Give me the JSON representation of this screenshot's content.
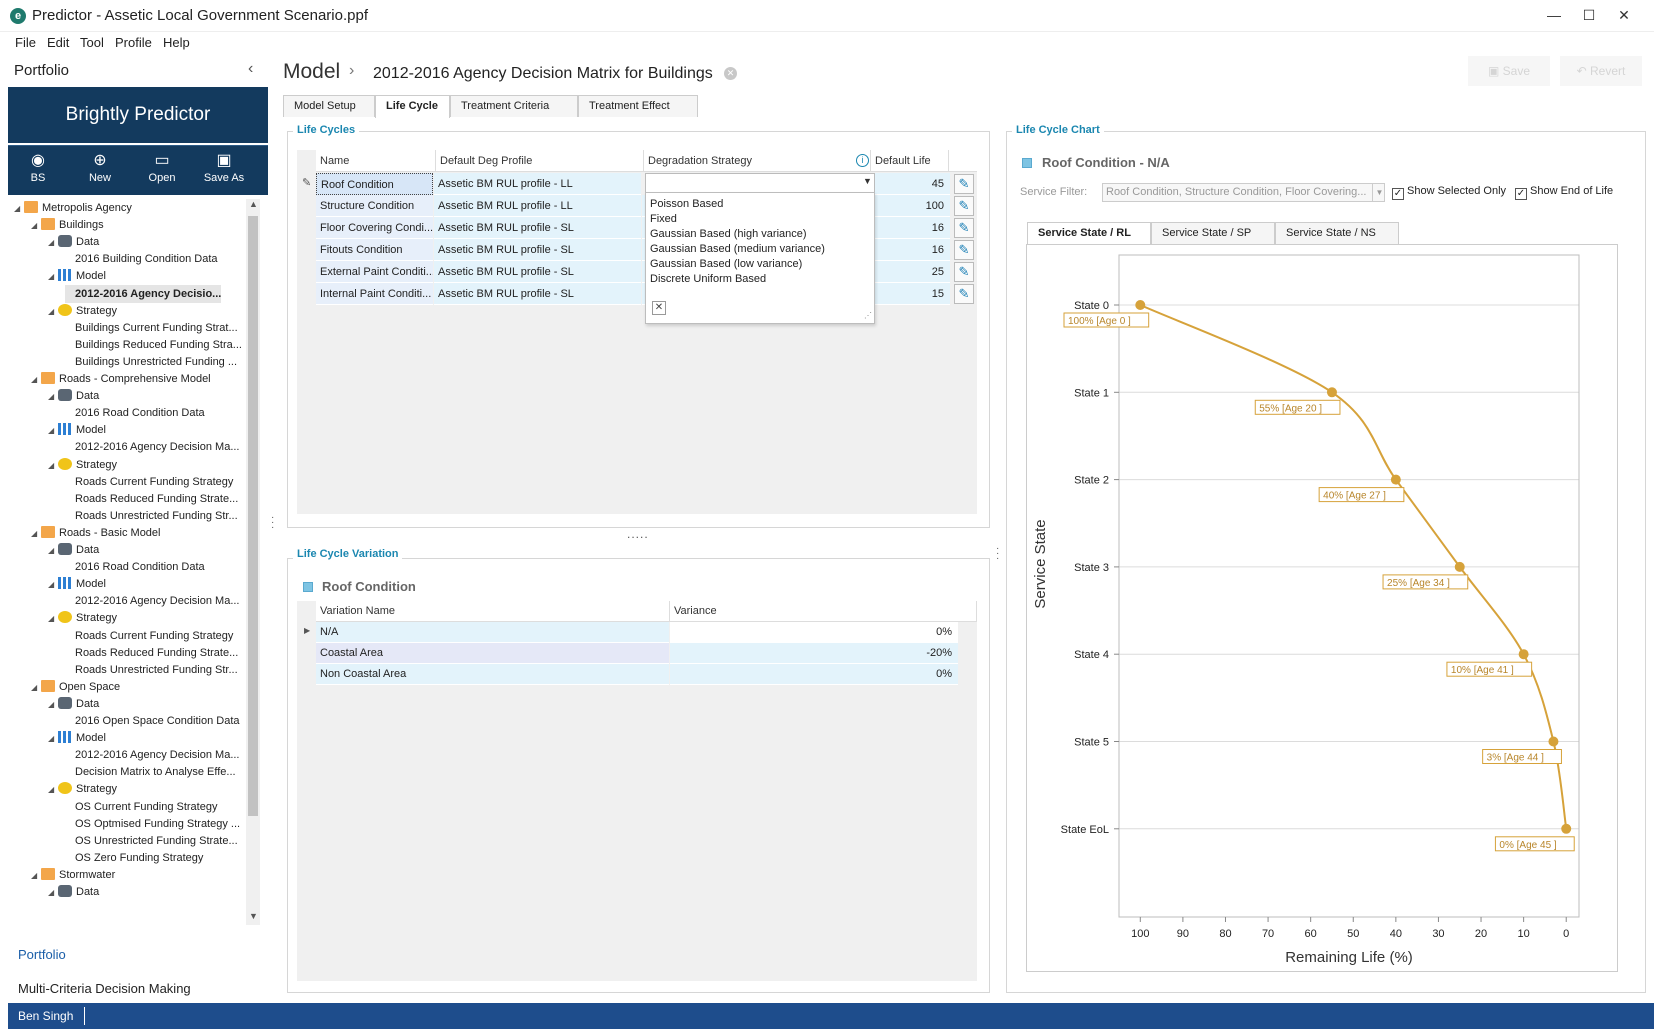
{
  "window": {
    "title": "Predictor - Assetic Local Government Scenario.ppf",
    "logo": "e",
    "controls": [
      "—",
      "☐",
      "✕"
    ]
  },
  "menu": [
    "File",
    "Edit",
    "Tool",
    "Profile",
    "Help"
  ],
  "left_pane": {
    "header": "Portfolio",
    "brand": "Brightly Predictor",
    "toolbar": [
      {
        "label": "BS",
        "icon": "user-icon"
      },
      {
        "label": "New",
        "icon": "plus-icon"
      },
      {
        "label": "Open",
        "icon": "folder-open-icon"
      },
      {
        "label": "Save As",
        "icon": "save-icon"
      }
    ],
    "tree": [
      {
        "indent": 0,
        "icon": "folder",
        "label": "Metropolis Agency",
        "expand": "◢"
      },
      {
        "indent": 1,
        "icon": "folder",
        "label": "Buildings",
        "expand": "◢"
      },
      {
        "indent": 2,
        "icon": "data",
        "label": "Data",
        "expand": "◢"
      },
      {
        "indent": 3,
        "icon": "",
        "label": "2016 Building Condition Data",
        "expand": ""
      },
      {
        "indent": 2,
        "icon": "model",
        "label": "Model",
        "expand": "◢"
      },
      {
        "indent": 3,
        "icon": "",
        "label": "2012-2016 Agency Decisio...",
        "expand": "",
        "selected": true
      },
      {
        "indent": 2,
        "icon": "strategy",
        "label": "Strategy",
        "expand": "◢"
      },
      {
        "indent": 3,
        "icon": "",
        "label": "Buildings Current Funding Strat...",
        "expand": ""
      },
      {
        "indent": 3,
        "icon": "",
        "label": "Buildings Reduced Funding Stra...",
        "expand": ""
      },
      {
        "indent": 3,
        "icon": "",
        "label": "Buildings Unrestricted Funding ...",
        "expand": ""
      },
      {
        "indent": 1,
        "icon": "folder",
        "label": "Roads - Comprehensive Model",
        "expand": "◢"
      },
      {
        "indent": 2,
        "icon": "data",
        "label": "Data",
        "expand": "◢"
      },
      {
        "indent": 3,
        "icon": "",
        "label": "2016 Road Condition Data",
        "expand": ""
      },
      {
        "indent": 2,
        "icon": "model",
        "label": "Model",
        "expand": "◢"
      },
      {
        "indent": 3,
        "icon": "",
        "label": "2012-2016 Agency Decision Ma...",
        "expand": ""
      },
      {
        "indent": 2,
        "icon": "strategy",
        "label": "Strategy",
        "expand": "◢"
      },
      {
        "indent": 3,
        "icon": "",
        "label": "Roads Current Funding Strategy",
        "expand": ""
      },
      {
        "indent": 3,
        "icon": "",
        "label": "Roads Reduced Funding Strate...",
        "expand": ""
      },
      {
        "indent": 3,
        "icon": "",
        "label": "Roads Unrestricted Funding Str...",
        "expand": ""
      },
      {
        "indent": 1,
        "icon": "folder",
        "label": "Roads - Basic Model",
        "expand": "◢"
      },
      {
        "indent": 2,
        "icon": "data",
        "label": "Data",
        "expand": "◢"
      },
      {
        "indent": 3,
        "icon": "",
        "label": "2016 Road Condition Data",
        "expand": ""
      },
      {
        "indent": 2,
        "icon": "model",
        "label": "Model",
        "expand": "◢"
      },
      {
        "indent": 3,
        "icon": "",
        "label": "2012-2016 Agency Decision Ma...",
        "expand": ""
      },
      {
        "indent": 2,
        "icon": "strategy",
        "label": "Strategy",
        "expand": "◢"
      },
      {
        "indent": 3,
        "icon": "",
        "label": "Roads Current Funding Strategy",
        "expand": ""
      },
      {
        "indent": 3,
        "icon": "",
        "label": "Roads Reduced Funding Strate...",
        "expand": ""
      },
      {
        "indent": 3,
        "icon": "",
        "label": "Roads Unrestricted Funding Str...",
        "expand": ""
      },
      {
        "indent": 1,
        "icon": "folder",
        "label": "Open Space",
        "expand": "◢"
      },
      {
        "indent": 2,
        "icon": "data",
        "label": "Data",
        "expand": "◢"
      },
      {
        "indent": 3,
        "icon": "",
        "label": "2016 Open Space Condition Data",
        "expand": ""
      },
      {
        "indent": 2,
        "icon": "model",
        "label": "Model",
        "expand": "◢"
      },
      {
        "indent": 3,
        "icon": "",
        "label": "2012-2016 Agency Decision Ma...",
        "expand": ""
      },
      {
        "indent": 3,
        "icon": "",
        "label": "Decision Matrix to Analyse Effe...",
        "expand": ""
      },
      {
        "indent": 2,
        "icon": "strategy",
        "label": "Strategy",
        "expand": "◢"
      },
      {
        "indent": 3,
        "icon": "",
        "label": "OS Current Funding Strategy",
        "expand": ""
      },
      {
        "indent": 3,
        "icon": "",
        "label": "OS Optmised Funding Strategy ...",
        "expand": ""
      },
      {
        "indent": 3,
        "icon": "",
        "label": "OS Unrestricted Funding Strate...",
        "expand": ""
      },
      {
        "indent": 3,
        "icon": "",
        "label": "OS Zero Funding Strategy",
        "expand": ""
      },
      {
        "indent": 1,
        "icon": "folder",
        "label": "Stormwater",
        "expand": "◢"
      },
      {
        "indent": 2,
        "icon": "data",
        "label": "Data",
        "expand": "◢"
      }
    ],
    "nav": {
      "portfolio": "Portfolio",
      "mcdm": "Multi-Criteria Decision Making"
    }
  },
  "status": {
    "user": "Ben Singh"
  },
  "header": {
    "section": "Model",
    "title": "2012-2016 Agency Decision Matrix for Buildings",
    "save": "Save",
    "revert": "Revert"
  },
  "tabs": [
    "Model Setup",
    "Life Cycle",
    "Treatment Criteria",
    "Treatment Effect"
  ],
  "life_cycles": {
    "title": "Life Cycles",
    "columns": [
      "Name",
      "Default Deg Profile",
      "Degradation Strategy",
      "Default Life"
    ],
    "rows": [
      {
        "name": "Roof Condition",
        "profile": "Assetic BM RUL profile - LL",
        "life": "45"
      },
      {
        "name": "Structure Condition",
        "profile": "Assetic BM RUL profile - LL",
        "life": "100"
      },
      {
        "name": "Floor Covering Condi...",
        "profile": "Assetic BM RUL profile - SL",
        "life": "16"
      },
      {
        "name": "Fitouts Condition",
        "profile": "Assetic BM RUL profile - SL",
        "life": "16"
      },
      {
        "name": "External Paint Conditi...",
        "profile": "Assetic BM RUL profile - SL",
        "life": "25"
      },
      {
        "name": "Internal Paint Conditi...",
        "profile": "Assetic BM RUL profile - SL",
        "life": "15"
      }
    ],
    "dropdown_options": [
      "Poisson Based",
      "Fixed",
      "Gaussian Based (high variance)",
      "Gaussian Based (medium variance)",
      "Gaussian Based (low variance)",
      "Discrete Uniform Based"
    ]
  },
  "variation": {
    "title": "Life Cycle Variation",
    "subtitle": "Roof Condition",
    "columns": [
      "Variation Name",
      "Variance"
    ],
    "rows": [
      {
        "name": "N/A",
        "variance": "0%"
      },
      {
        "name": "Coastal Area",
        "variance": "-20%"
      },
      {
        "name": "Non Coastal Area",
        "variance": "0%"
      }
    ]
  },
  "chart_panel": {
    "title": "Life Cycle Chart",
    "subtitle": "Roof Condition - N/A",
    "service_filter_label": "Service Filter:",
    "service_filter_value": "Roof Condition, Structure Condition, Floor Covering...",
    "show_selected_only": "Show Selected Only",
    "show_end_of_life": "Show End of Life",
    "tabs": [
      "Service State / RL",
      "Service State / SP",
      "Service State / NS"
    ]
  },
  "chart_data": {
    "type": "line",
    "xlabel": "Remaining Life (%)",
    "ylabel": "Service State",
    "xlim": [
      105,
      -3
    ],
    "x_ticks": [
      100,
      90,
      80,
      70,
      60,
      50,
      40,
      30,
      20,
      10,
      0
    ],
    "y_categories": [
      "State 0",
      "State 1",
      "State 2",
      "State 3",
      "State 4",
      "State 5",
      "State EoL"
    ],
    "line_color": "#d6a23a",
    "points": [
      {
        "x": 100,
        "state": 0,
        "label": "100% [Age 0 ]"
      },
      {
        "x": 55,
        "state": 1,
        "label": "55% [Age 20 ]"
      },
      {
        "x": 40,
        "state": 2,
        "label": "40% [Age 27 ]"
      },
      {
        "x": 25,
        "state": 3,
        "label": "25% [Age 34 ]"
      },
      {
        "x": 10,
        "state": 4,
        "label": "10% [Age 41 ]"
      },
      {
        "x": 3,
        "state": 5,
        "label": "3% [Age 44 ]"
      },
      {
        "x": 0,
        "state": 6,
        "label": "0% [Age 45 ]"
      }
    ]
  }
}
